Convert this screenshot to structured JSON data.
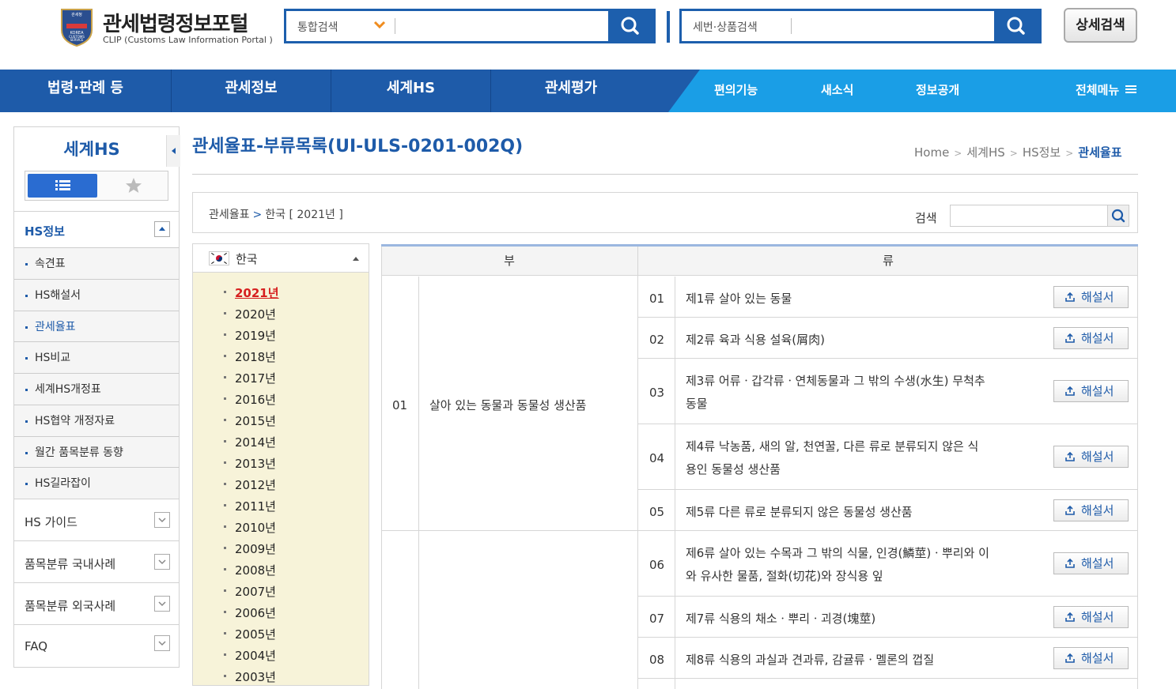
{
  "header": {
    "logo_title": "관세법령정보포털",
    "logo_subtitle": "CLIP (Customs Law Information Portal )",
    "emblem_lines": [
      "관세청",
      "KOREA",
      "CUSTOMS",
      "SERVICE"
    ],
    "search_main": {
      "scope": "통합검색",
      "value": ""
    },
    "search_code": {
      "scope": "세번·상품검색",
      "value": ""
    },
    "detail_search": "상세검색"
  },
  "nav": {
    "main": [
      "법령·판례 등",
      "관세정보",
      "세계HS",
      "관세평가"
    ],
    "sub": [
      "편의기능",
      "새소식",
      "정보공개"
    ],
    "all_menu": "전체메뉴"
  },
  "sidebar": {
    "title": "세계HS",
    "section_hs": "HS정보",
    "items": [
      "속견표",
      "HS해설서",
      "관세율표",
      "HS비교",
      "세계HS개정표",
      "HS협약 개정자료",
      "월간 품목분류 동향",
      "HS길라잡이"
    ],
    "active_item": "관세율표",
    "sections": [
      "HS 가이드",
      "품목분류 국내사례",
      "품목분류 외국사례",
      "FAQ"
    ]
  },
  "page": {
    "title": "관세율표-부류목록(UI-ULS-0201-002Q)",
    "breadcrumb": [
      "Home",
      "세계HS",
      "HS정보",
      "관세율표"
    ]
  },
  "filter": {
    "path_root": "관세율표",
    "path_country": "한국 [ 2021년 ]",
    "search_label": "검색",
    "search_value": ""
  },
  "year_panel": {
    "country": "한국",
    "years": [
      "2021년",
      "2020년",
      "2019년",
      "2018년",
      "2017년",
      "2016년",
      "2015년",
      "2014년",
      "2013년",
      "2012년",
      "2011년",
      "2010년",
      "2009년",
      "2008년",
      "2007년",
      "2006년",
      "2005년",
      "2004년",
      "2003년"
    ],
    "selected": "2021년"
  },
  "table": {
    "headers": [
      "부",
      "류"
    ],
    "sections": [
      {
        "no": "01",
        "name": "살아 있는 동물과 동물성 생산품"
      },
      {
        "no": "",
        "name": ""
      }
    ],
    "chapters": [
      {
        "no": "01",
        "text": [
          "제1류 살아 있는 동물"
        ],
        "button": "해설서"
      },
      {
        "no": "02",
        "text": [
          "제2류 육과 식용 설육(屑肉)"
        ],
        "button": "해설서"
      },
      {
        "no": "03",
        "text": [
          "제3류 어류ㆍ갑각류ㆍ연체동물과 그 밖의 수생(水生) 무척추",
          "동물"
        ],
        "button": "해설서"
      },
      {
        "no": "04",
        "text": [
          "제4류 낙농품, 새의 알, 천연꿀, 다른 류로 분류되지 않은 식",
          "용인 동물성 생산품"
        ],
        "button": "해설서"
      },
      {
        "no": "05",
        "text": [
          "제5류 다른 류로 분류되지 않은 동물성 생산품"
        ],
        "button": "해설서"
      },
      {
        "no": "06",
        "text": [
          "제6류 살아 있는 수목과 그 밖의 식물, 인경(鱗莖)ㆍ뿌리와 이",
          "와 유사한 물품, 절화(切花)와 장식용 잎"
        ],
        "button": "해설서"
      },
      {
        "no": "07",
        "text": [
          "제7류 식용의 채소ㆍ뿌리ㆍ괴경(塊莖)"
        ],
        "button": "해설서"
      },
      {
        "no": "08",
        "text": [
          "제8류 식용의 과실과 견과류, 감귤류ㆍ멜론의 껍질"
        ],
        "button": "해설서"
      }
    ]
  },
  "colors": {
    "brand": "#1e5ba9",
    "nav_sub": "#1a9ee6",
    "year_panel": "#f7f3d9",
    "selected_year": "#d61f1f"
  }
}
